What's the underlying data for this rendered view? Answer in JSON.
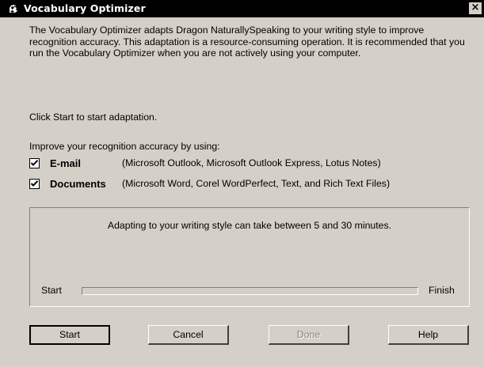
{
  "window": {
    "title": "Vocabulary Optimizer",
    "close_symbol": "×"
  },
  "content": {
    "description": "The Vocabulary Optimizer adapts Dragon NaturallySpeaking to your writing style to improve recognition accuracy.  This adaptation is a resource-consuming operation. It is recommended that you run the Vocabulary Optimizer when you are not actively using your computer.",
    "instruction": "Click Start to start adaptation.",
    "improve_label": "Improve your recognition accuracy by using:",
    "options": [
      {
        "name": "E-mail",
        "description": "(Microsoft Outlook, Microsoft Outlook Express, Lotus Notes)",
        "checked": true
      },
      {
        "name": "Documents",
        "description": "(Microsoft Word, Corel WordPerfect, Text, and Rich Text Files)",
        "checked": true
      }
    ]
  },
  "progress": {
    "message": "Adapting to your writing style can take between 5 and 30 minutes.",
    "start_label": "Start",
    "finish_label": "Finish",
    "fraction": 0
  },
  "buttons": {
    "start": "Start",
    "cancel": "Cancel",
    "done": "Done",
    "help": "Help"
  },
  "icons": {
    "app": "dragon-app-icon",
    "close": "close-icon",
    "check": "checkmark-icon"
  },
  "colors": {
    "titlebar": "#000000",
    "dialog": "#d4d0c8",
    "disabled_text": "#808080"
  }
}
